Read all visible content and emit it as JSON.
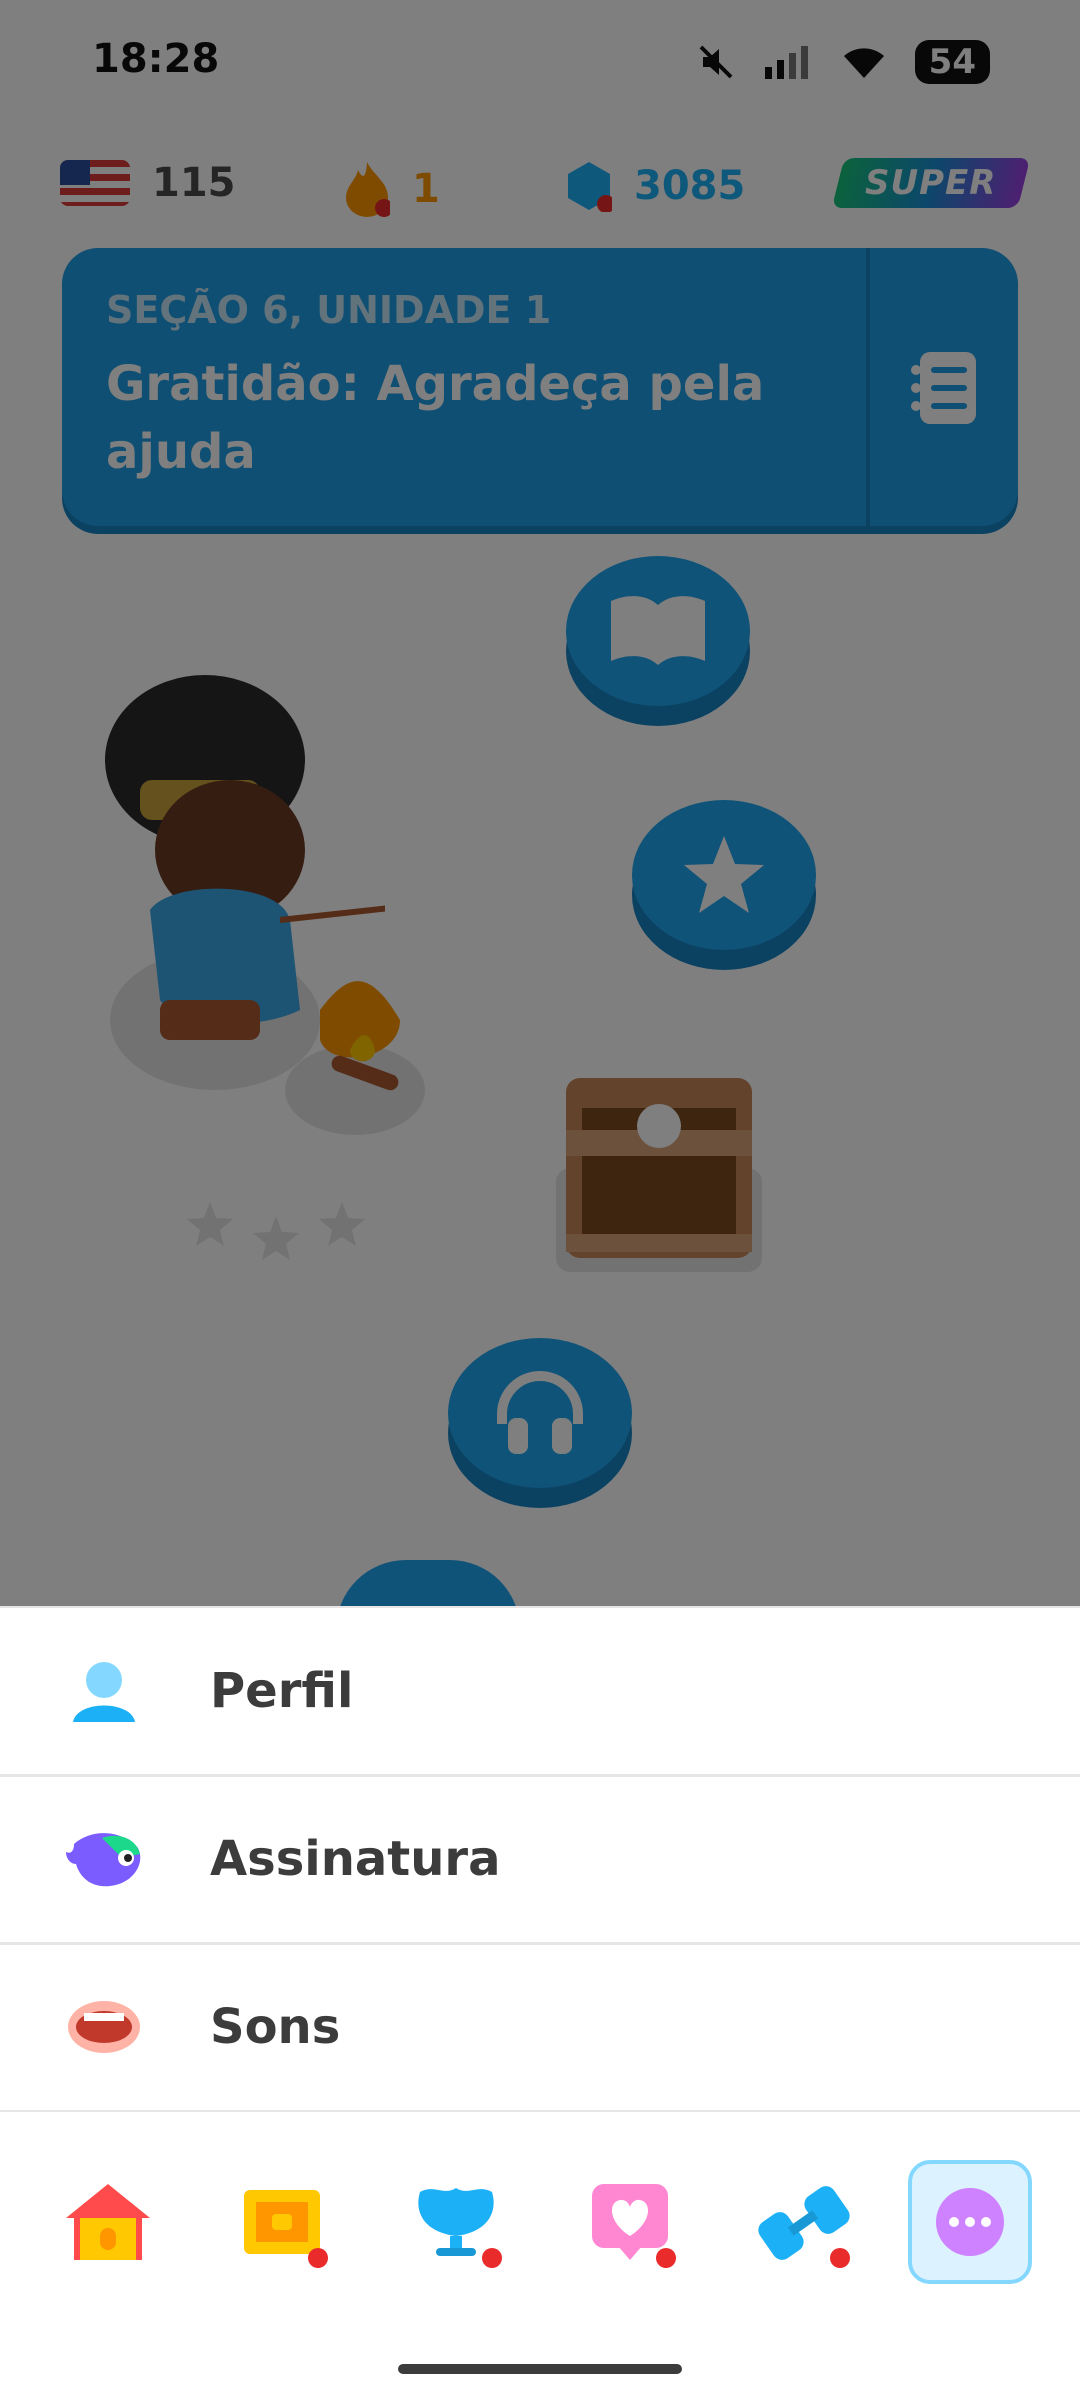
{
  "status_bar": {
    "time": "18:28",
    "battery": "54"
  },
  "top_bar": {
    "course_flag": "us-flag-icon",
    "course_count": "115",
    "streak": "1",
    "gems": "3085",
    "super_badge": "SUPER"
  },
  "unit": {
    "subtitle": "SEÇÃO 6, UNIDADE 1",
    "title": "Gratidão: Agradeça pela ajuda"
  },
  "path_nodes": [
    "book-icon",
    "star-icon",
    "treasure-chest-icon",
    "headphones-icon"
  ],
  "menu": {
    "items": [
      {
        "label": "Perfil",
        "icon": "profile-icon"
      },
      {
        "label": "Assinatura",
        "icon": "subscription-icon"
      },
      {
        "label": "Sons",
        "icon": "sounds-icon"
      }
    ]
  },
  "bottom_nav": [
    "home-icon",
    "chest-icon",
    "league-icon",
    "hearts-icon",
    "practice-icon",
    "more-icon"
  ],
  "colors": {
    "accent": "#1fa6f0",
    "streak": "#ff9600",
    "gems": "#1cb0f6",
    "more": "#ce82ff"
  }
}
